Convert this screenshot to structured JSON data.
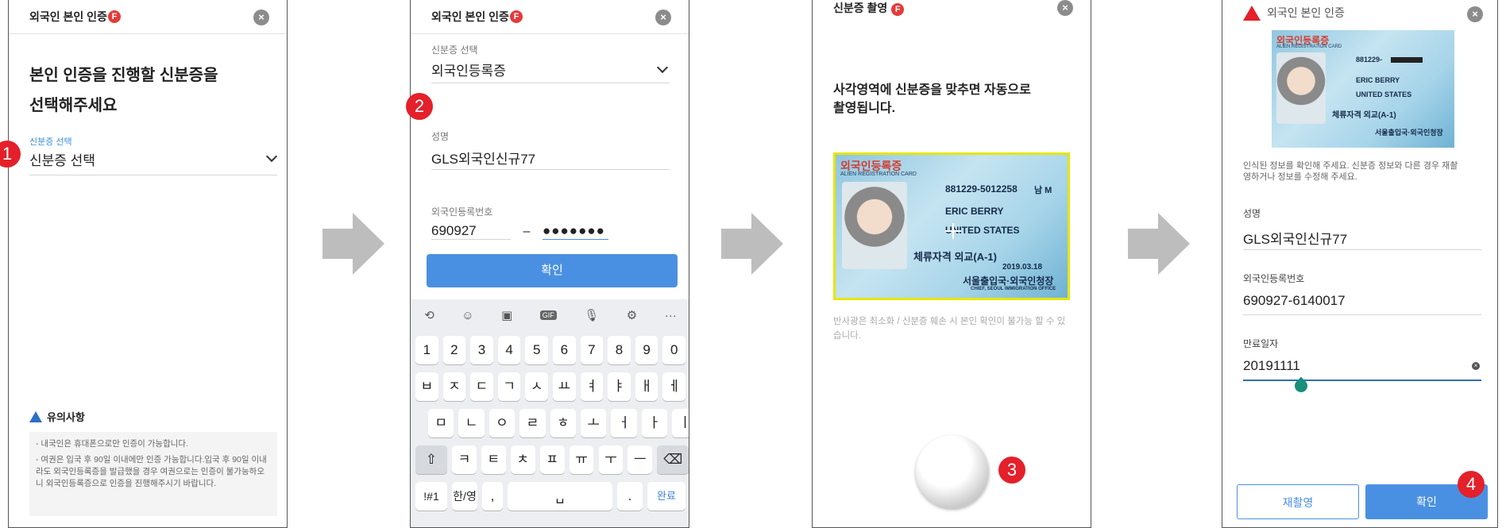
{
  "screen1": {
    "header_title": "외국인 본인 인증",
    "badge": "F",
    "close_icon": "×",
    "heading_line1": "본인 인증을 진행할 신분증을",
    "heading_line2": "선택해주세요",
    "id_label": "신분증 선택",
    "id_value": "신분증 선택",
    "step": "1",
    "notice_title": "유의사항",
    "notice_item1": "- 내국인은 휴대폰으로만 인증이 가능합니다.",
    "notice_item2": "- 여권은 입국 후 90일 이내에만 인증 가능합니다.입국 후 90일 이내라도 외국인등록증을 발급했을 경우 여권으로는 인증이 불가능하오니 외국인등록증으로 인증을 진행해주시기 바랍니다."
  },
  "screen2": {
    "header_title": "외국인 본인 인증",
    "badge": "F",
    "close_icon": "×",
    "id_label": "신분증 선택",
    "id_value": "외국인등록증",
    "step": "2",
    "name_label": "성명",
    "name_value": "GLS외국인신규77",
    "reg_label": "외국인등록번호",
    "reg_front": "690927",
    "reg_dash": "–",
    "reg_back": "●●●●●●●",
    "confirm": "확인",
    "keyboard": {
      "toolbar": [
        "⟲",
        "☺",
        "▣",
        "GIF",
        "🎙",
        "⚙",
        "···"
      ],
      "row1": [
        "1",
        "2",
        "3",
        "4",
        "5",
        "6",
        "7",
        "8",
        "9",
        "0"
      ],
      "row2": [
        "ㅂ",
        "ㅈ",
        "ㄷ",
        "ㄱ",
        "ㅅ",
        "ㅛ",
        "ㅕ",
        "ㅑ",
        "ㅐ",
        "ㅔ"
      ],
      "row3": [
        "ㅁ",
        "ㄴ",
        "ㅇ",
        "ㄹ",
        "ㅎ",
        "ㅗ",
        "ㅓ",
        "ㅏ",
        "ㅣ"
      ],
      "row4": [
        "⇧",
        "ㅋ",
        "ㅌ",
        "ㅊ",
        "ㅍ",
        "ㅠ",
        "ㅜ",
        "ㅡ",
        "⌫"
      ],
      "row5": [
        "!#1",
        "한/영",
        ",",
        "␣",
        ".",
        "완료"
      ]
    }
  },
  "screen3": {
    "header_title": "신분증 촬영",
    "badge": "F",
    "close_icon": "×",
    "instruction_line1": "사각영역에 신분증을 맞추면 자동으로",
    "instruction_line2": "촬영됩니다.",
    "warning": "반사광은 최소화 / 신분증 훼손 시 본인 확인이 불가능 할 수 있습니다.",
    "step": "3",
    "card": {
      "title": "외국인등록증",
      "subtitle": "ALIEN REGISTRATION CARD",
      "number": "881229-5012258",
      "sex": "남 M",
      "name": "ERIC BERRY",
      "country": "UNITED STATES",
      "status": "체류자격 외교(A-1)",
      "issue_date": "2019.03.18",
      "issuer": "서울출입국·외국인청장",
      "issuer_en": "CHIEF, SEOUL IMMIGRATION OFFICE"
    }
  },
  "screen4": {
    "header_title": "외국인 본인 인증",
    "close_icon": "×",
    "info_text": "인식된 정보를 확인해 주세요. 신분증 정보와 다른 경우 재촬영하거나 정보를 수정해 주세요.",
    "name_label": "성명",
    "name_value": "GLS외국인신규77",
    "reg_label": "외국인등록번호",
    "reg_value": "690927-6140017",
    "exp_label": "만료일자",
    "exp_value": "20191111",
    "retake": "재촬영",
    "confirm": "확인",
    "step": "4",
    "card": {
      "title": "외국인등록증",
      "subtitle": "ALIEN REGISTRATION CARD",
      "number": "881229-",
      "name": "ERIC BERRY",
      "country": "UNITED STATES",
      "status": "체류자격 외교(A-1)",
      "issuer": "서울출입국·외국인청장"
    }
  },
  "colors": {
    "accent": "#4a90e2",
    "step_badge": "#e4202a",
    "arrow": "#bdbdbd",
    "teal_handle": "#1a8f7a"
  }
}
